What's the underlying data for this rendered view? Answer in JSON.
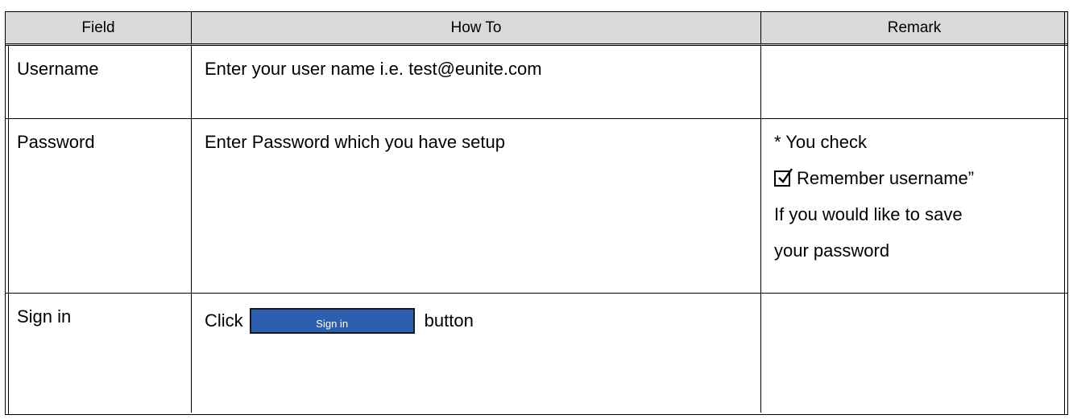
{
  "table": {
    "headers": {
      "field": "Field",
      "how_to": "How To",
      "remark": "Remark"
    },
    "rows": [
      {
        "field": "Username",
        "how_to": "Enter your user name i.e. test@eunite.com"
      },
      {
        "field": "Password",
        "how_to": "Enter Password which you have setup",
        "remark": {
          "line1": "* You check",
          "checkbox_label": "Remember username”",
          "line3": "If you would like to save",
          "line4": "your password"
        }
      },
      {
        "field": "Sign in",
        "how_to_prefix": "Click",
        "button_label": "Sign in",
        "how_to_suffix": "button"
      }
    ]
  },
  "colors": {
    "header_bg": "#d9d9d9",
    "button_bg": "#2d5fb0",
    "button_text": "#ffffff"
  },
  "icons": {
    "checkbox": "checked-box-icon"
  }
}
